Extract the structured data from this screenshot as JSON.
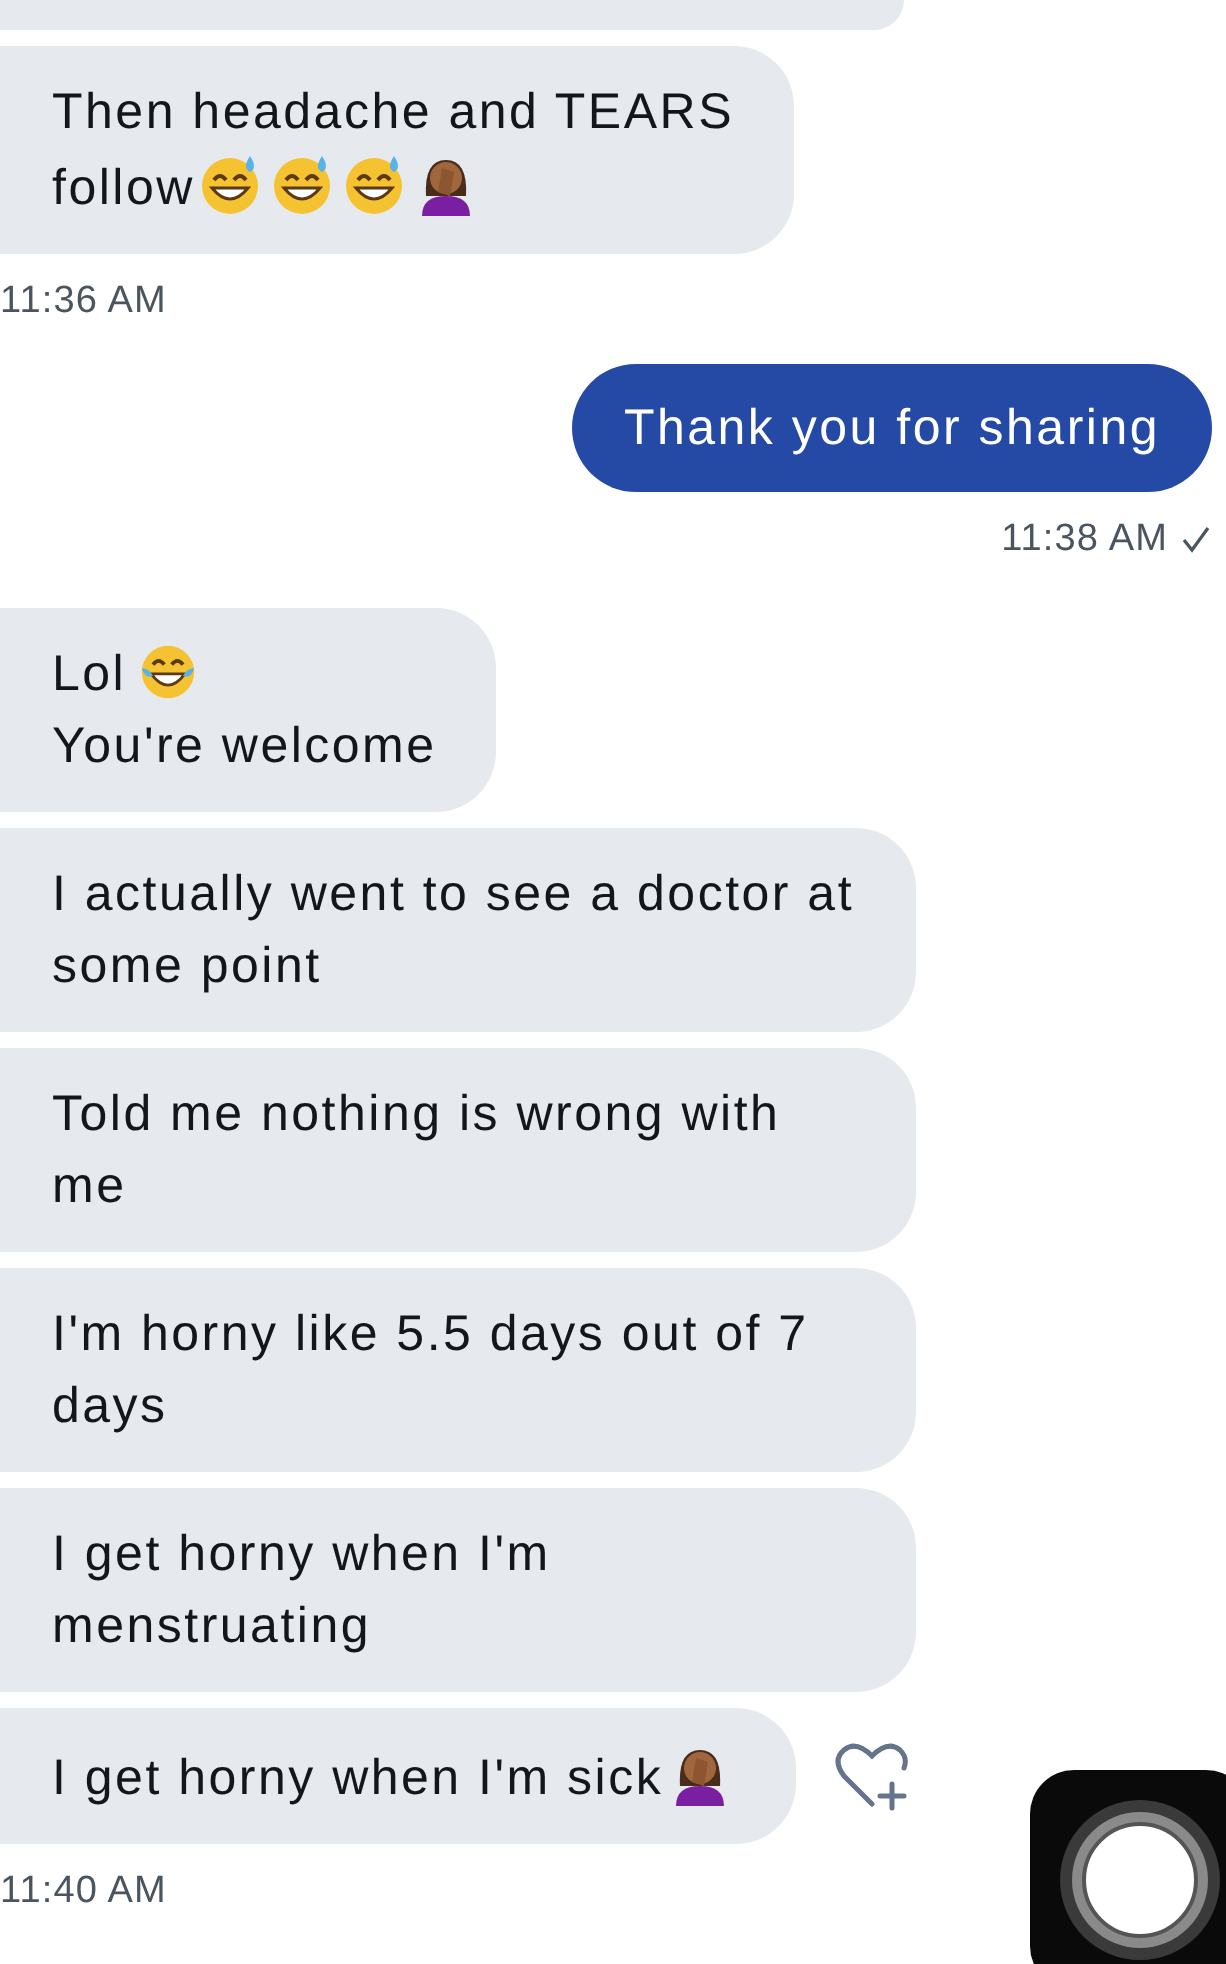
{
  "groups": [
    {
      "kind": "received",
      "messages": [
        {
          "kind": "partial"
        },
        {
          "parts": [
            {
              "kind": "text",
              "text": "Then headache and TEARS"
            },
            {
              "kind": "line_break"
            },
            {
              "kind": "text",
              "text": "follow"
            },
            {
              "kind": "sweat_smile"
            },
            {
              "kind": "sweat_smile"
            },
            {
              "kind": "sweat_smile"
            },
            {
              "kind": "facepalm"
            }
          ]
        }
      ],
      "time": "11:36 AM"
    },
    {
      "kind": "sent",
      "messages": [
        {
          "parts": [
            {
              "kind": "text",
              "text": "Thank you for sharing"
            }
          ]
        }
      ],
      "time": "11:38 AM",
      "read": true
    },
    {
      "kind": "received",
      "messages": [
        {
          "parts": [
            {
              "kind": "text",
              "text": "Lol"
            },
            {
              "kind": "joy"
            },
            {
              "kind": "line_break"
            },
            {
              "kind": "text",
              "text": "You're welcome"
            }
          ]
        },
        {
          "parts": [
            {
              "kind": "text",
              "text": "I actually went to see a doctor at some point"
            }
          ]
        },
        {
          "parts": [
            {
              "kind": "text",
              "text": "Told me nothing is wrong with me"
            }
          ]
        },
        {
          "parts": [
            {
              "kind": "text",
              "text": "I'm horny like 5.5 days out of 7 days"
            }
          ]
        },
        {
          "parts": [
            {
              "kind": "text",
              "text": "I get horny when I'm menstruating"
            }
          ]
        },
        {
          "parts": [
            {
              "kind": "text",
              "text": "I get horny when I'm sick"
            },
            {
              "kind": "facepalm"
            }
          ],
          "reaction_button": true
        }
      ],
      "time": "11:40 AM"
    }
  ]
}
